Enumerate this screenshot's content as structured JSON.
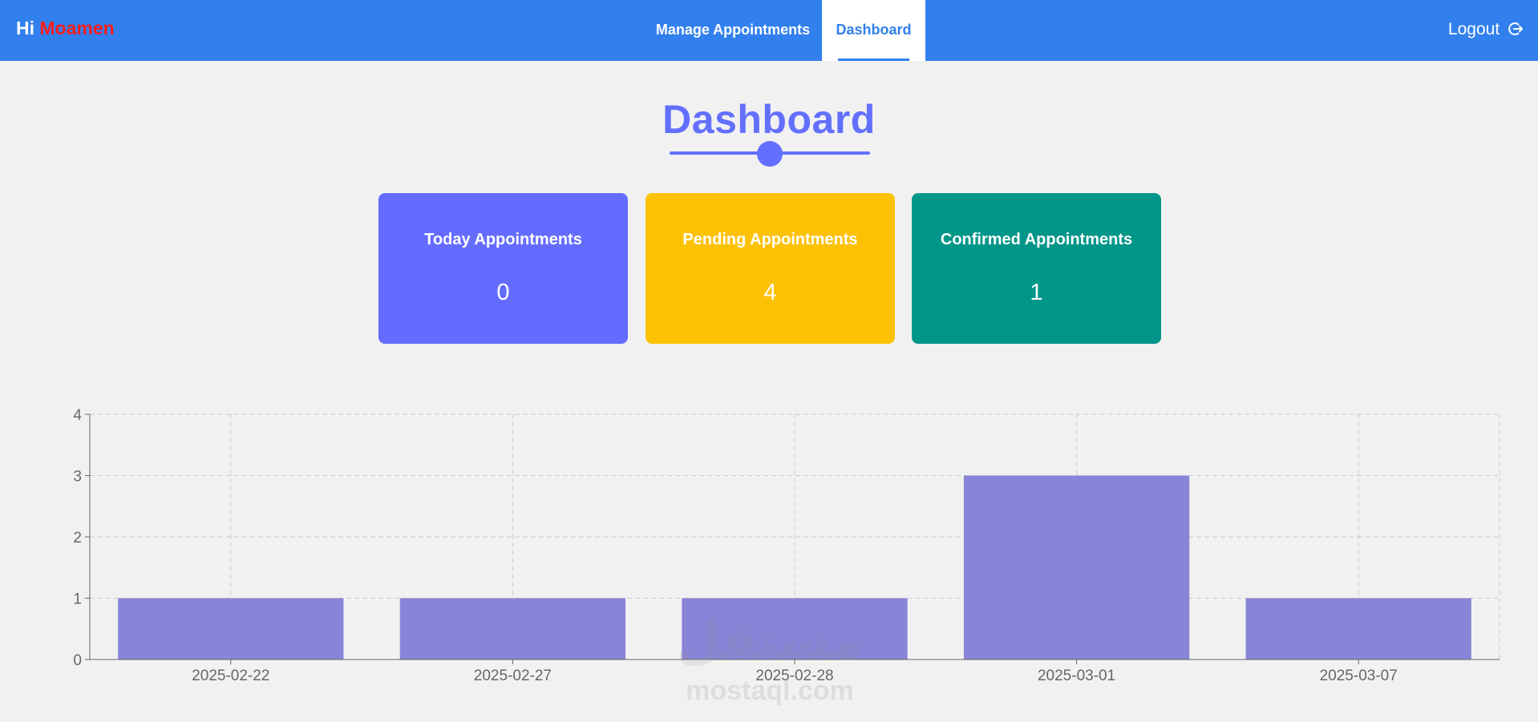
{
  "navbar": {
    "greeting_prefix": "Hi",
    "username": "Moamen",
    "links": [
      {
        "label": "Manage Appointments",
        "active": false
      },
      {
        "label": "Dashboard",
        "active": true
      }
    ],
    "logout_label": "Logout",
    "logout_icon": "logout-icon",
    "background": "#3280ed"
  },
  "page": {
    "title": "Dashboard",
    "accent": "#6370ff"
  },
  "cards": [
    {
      "label": "Today Appointments",
      "value": "0",
      "color": "#646cff"
    },
    {
      "label": "Pending Appointments",
      "value": "4",
      "color": "#fdc106"
    },
    {
      "label": "Confirmed Appointments",
      "value": "1",
      "color": "#00968a"
    }
  ],
  "chart_data": {
    "type": "bar",
    "categories": [
      "2025-02-22",
      "2025-02-27",
      "2025-02-28",
      "2025-03-01",
      "2025-03-07"
    ],
    "values": [
      1,
      1,
      1,
      3,
      1
    ],
    "ylim": [
      0,
      4
    ],
    "yticks": [
      0,
      1,
      2,
      3,
      4
    ],
    "grid": true,
    "bar_color": "#8884d8",
    "title": "",
    "xlabel": "",
    "ylabel": ""
  },
  "watermark": {
    "arabic": "مستقل",
    "text": "mostaql.com"
  }
}
